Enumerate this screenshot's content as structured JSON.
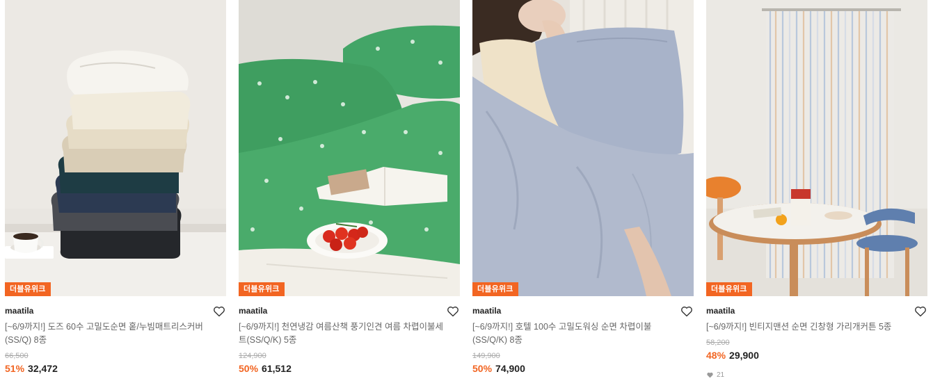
{
  "colors": {
    "accent": "#F26522",
    "badge_bg": "#F26522",
    "muted_text": "#666666"
  },
  "products": [
    {
      "image": "stacked-folded-bedding-image",
      "badge": "더블유위크",
      "brand": "maatila",
      "title": "[~6/9까지!] 도즈 60수 고밀도순면 홑/누빔매트리스커버(SS/Q) 8종",
      "original_price": "66,500",
      "discount": "51%",
      "price": "32,472",
      "likes": null
    },
    {
      "image": "green-floral-bedding-image",
      "badge": "더블유위크",
      "brand": "maatila",
      "title": "[~6/9까지!] 천연냉감 여름산책 풍기인견 여름 차렵이불세트(SS/Q/K) 5종",
      "original_price": "124,900",
      "discount": "50%",
      "price": "61,512",
      "likes": null
    },
    {
      "image": "blue-duvet-woman-image",
      "badge": "더블유위크",
      "brand": "maatila",
      "title": "[~6/9까지!] 호텔 100수 고밀도워싱 순면 차렵이불(SS/Q/K) 8종",
      "original_price": "149,900",
      "discount": "50%",
      "price": "74,900",
      "likes": null
    },
    {
      "image": "striped-curtain-room-image",
      "badge": "더블유위크",
      "brand": "maatila",
      "title": "[~6/9까지!] 빈티지맨션 순면 긴창형 가리개커튼 5종",
      "original_price": "58,200",
      "discount": "48%",
      "price": "29,900",
      "likes": "21"
    }
  ]
}
